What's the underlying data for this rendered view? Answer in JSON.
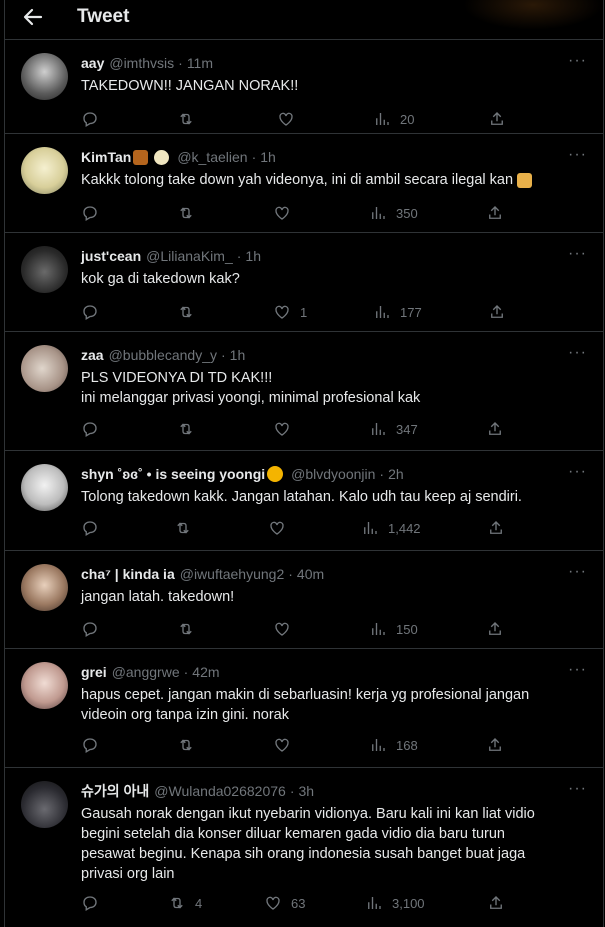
{
  "header": {
    "title": "Tweet"
  },
  "tweets": [
    {
      "name": "aay",
      "handle": "@imthvsis",
      "time": "11m",
      "text": [
        "TAKEDOWN!! JANGAN NORAK!!"
      ],
      "replies": "",
      "retweets": "",
      "likes": "",
      "views": "20",
      "avatar_color": "#9a9a9a"
    },
    {
      "name": "KimTan",
      "handle": "@k_taelien",
      "time": "1h",
      "text": [
        "Kakkk tolong take down yah videonya, ini di ambil secara ilegal kan"
      ],
      "replies": "",
      "retweets": "",
      "likes": "",
      "views": "350",
      "avatar_color": "#e8e0b0"
    },
    {
      "name": "just'cean",
      "handle": "@LilianaKim_",
      "time": "1h",
      "text": [
        "kok ga di takedown kak?"
      ],
      "replies": "",
      "retweets": "",
      "likes": "1",
      "views": "177",
      "avatar_color": "#2a2a2a"
    },
    {
      "name": "zaa",
      "handle": "@bubblecandy_y",
      "time": "1h",
      "text": [
        "PLS VIDEONYA DI TD KAK!!!",
        "ini melanggar privasi yoongi, minimal profesional kak"
      ],
      "replies": "",
      "retweets": "",
      "likes": "",
      "views": "347",
      "avatar_color": "#c8b9b0"
    },
    {
      "name": "shyn ˚ʚɞ˚ • is seeing yoongi",
      "handle": "@blvdyoonjin",
      "time": "2h",
      "text": [
        "Tolong takedown kakk. Jangan latahan. Kalo udh tau keep aj sendiri."
      ],
      "replies": "",
      "retweets": "",
      "likes": "",
      "views": "1,442",
      "avatar_color": "#d9d9d9"
    },
    {
      "name": "cha⁷ | kinda ia",
      "handle": "@iwuftaehyung2",
      "time": "40m",
      "text": [
        "jangan latah. takedown!"
      ],
      "replies": "",
      "retweets": "",
      "likes": "",
      "views": "150",
      "avatar_color": "#b08a70"
    },
    {
      "name": "grei",
      "handle": "@anggrwe",
      "time": "42m",
      "text": [
        "hapus cepet. jangan makin di sebarluasin! kerja yg profesional jangan",
        "videoin org tanpa izin gini. norak"
      ],
      "replies": "",
      "retweets": "",
      "likes": "",
      "views": "168",
      "avatar_color": "#d8c8c0"
    },
    {
      "name": "슈가의 아내",
      "handle": "@Wulanda02682076",
      "time": "3h",
      "text": [
        "Gausah norak dengan ikut nyebarin vidionya. Baru kali ini kan liat vidio",
        "begini setelah dia konser diluar kemaren gada vidio dia baru turun",
        "pesawat beginu. Kenapa sih orang indonesia susah banget buat jaga",
        "privasi org lain"
      ],
      "replies": "",
      "retweets": "4",
      "likes": "63",
      "views": "3,100",
      "avatar_color": "#3a3a40"
    }
  ],
  "separator": "·",
  "more_glyph": "···",
  "back_glyph": "←",
  "icons": [
    "back-arrow-icon",
    "more-icon",
    "reply-icon",
    "retweet-icon",
    "like-icon",
    "views-icon",
    "share-icon"
  ]
}
